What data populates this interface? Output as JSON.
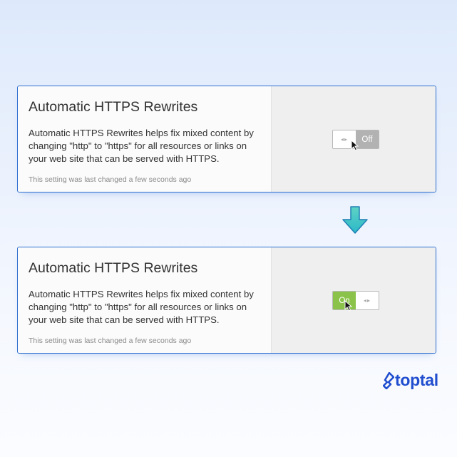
{
  "cards": [
    {
      "title": "Automatic HTTPS Rewrites",
      "description": "Automatic HTTPS Rewrites helps fix mixed content by changing \"http\" to \"https\" for all resources or links on your web site that can be served with HTTPS.",
      "meta": "This setting was last changed a few seconds ago",
      "toggle": {
        "state": "off",
        "label": "Off"
      }
    },
    {
      "title": "Automatic HTTPS Rewrites",
      "description": "Automatic HTTPS Rewrites helps fix mixed content by changing \"http\" to \"https\" for all resources or links on your web site that can be served with HTTPS.",
      "meta": "This setting was last changed a few seconds ago",
      "toggle": {
        "state": "on",
        "label": "On"
      }
    }
  ],
  "brand": {
    "name": "toptal",
    "color": "#204ecf"
  },
  "colors": {
    "accent_border": "#2f6fd0",
    "toggle_on": "#8bc34a",
    "toggle_off": "#b2b2b2",
    "arrow": "#3ec9c0"
  },
  "icons": {
    "transition": "down-arrow-icon",
    "cursor": "mouse-pointer-icon",
    "handle": "drag-handle-icon"
  }
}
